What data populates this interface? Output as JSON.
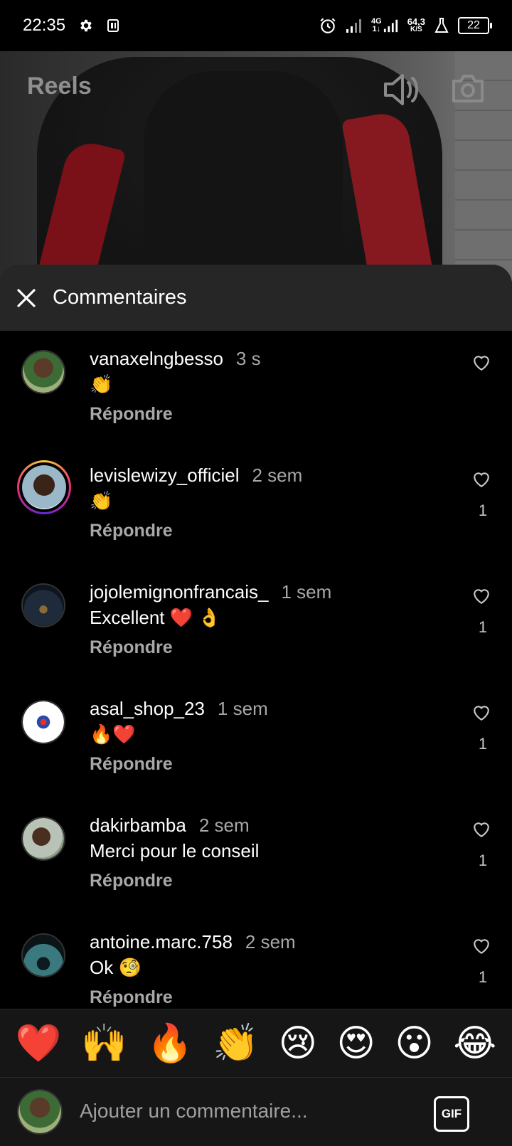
{
  "status_bar": {
    "time": "22:35",
    "network_gen": "4G",
    "network_sub": "1↓",
    "speed_value": "64,3",
    "speed_unit": "K/S",
    "battery": "22",
    "icons": [
      "gear-icon",
      "app-notification-icon",
      "alarm-icon",
      "signal-icon",
      "signal-4g-icon",
      "lab-icon",
      "battery-icon"
    ]
  },
  "header": {
    "title": "Reels",
    "icons": [
      "speaker-icon",
      "camera-icon"
    ]
  },
  "sheet": {
    "title": "Commentaires",
    "close_icon": "close-icon"
  },
  "comments": [
    {
      "username": "vanaxelngbesso",
      "time": "3 s",
      "text": "👏",
      "reply": "Répondre",
      "likes": ""
    },
    {
      "username": "levislewizy_officiel",
      "time": "2 sem",
      "text": "👏",
      "reply": "Répondre",
      "likes": "1"
    },
    {
      "username": "jojolemignonfrancais_",
      "time": "1 sem",
      "text": "Excellent ❤️ 👌",
      "reply": "Répondre",
      "likes": "1"
    },
    {
      "username": "asal_shop_23",
      "time": "1 sem",
      "text": "🔥❤️",
      "reply": "Répondre",
      "likes": "1"
    },
    {
      "username": "dakirbamba",
      "time": "2 sem",
      "text": "Merci pour le conseil",
      "reply": "Répondre",
      "likes": "1"
    },
    {
      "username": "antoine.marc.758",
      "time": "2 sem",
      "text": "Ok 🧐",
      "reply": "Répondre",
      "likes": "1"
    }
  ],
  "emoji_bar": [
    "❤️",
    "🙌",
    "🔥",
    "👏",
    "😢",
    "😍",
    "😮",
    "😂"
  ],
  "composer": {
    "placeholder": "Ajouter un commentaire...",
    "gif_label": "GIF"
  },
  "colors": {
    "background": "#000000",
    "sheet_header": "#262626",
    "secondary_text": "#a8a8a8"
  }
}
